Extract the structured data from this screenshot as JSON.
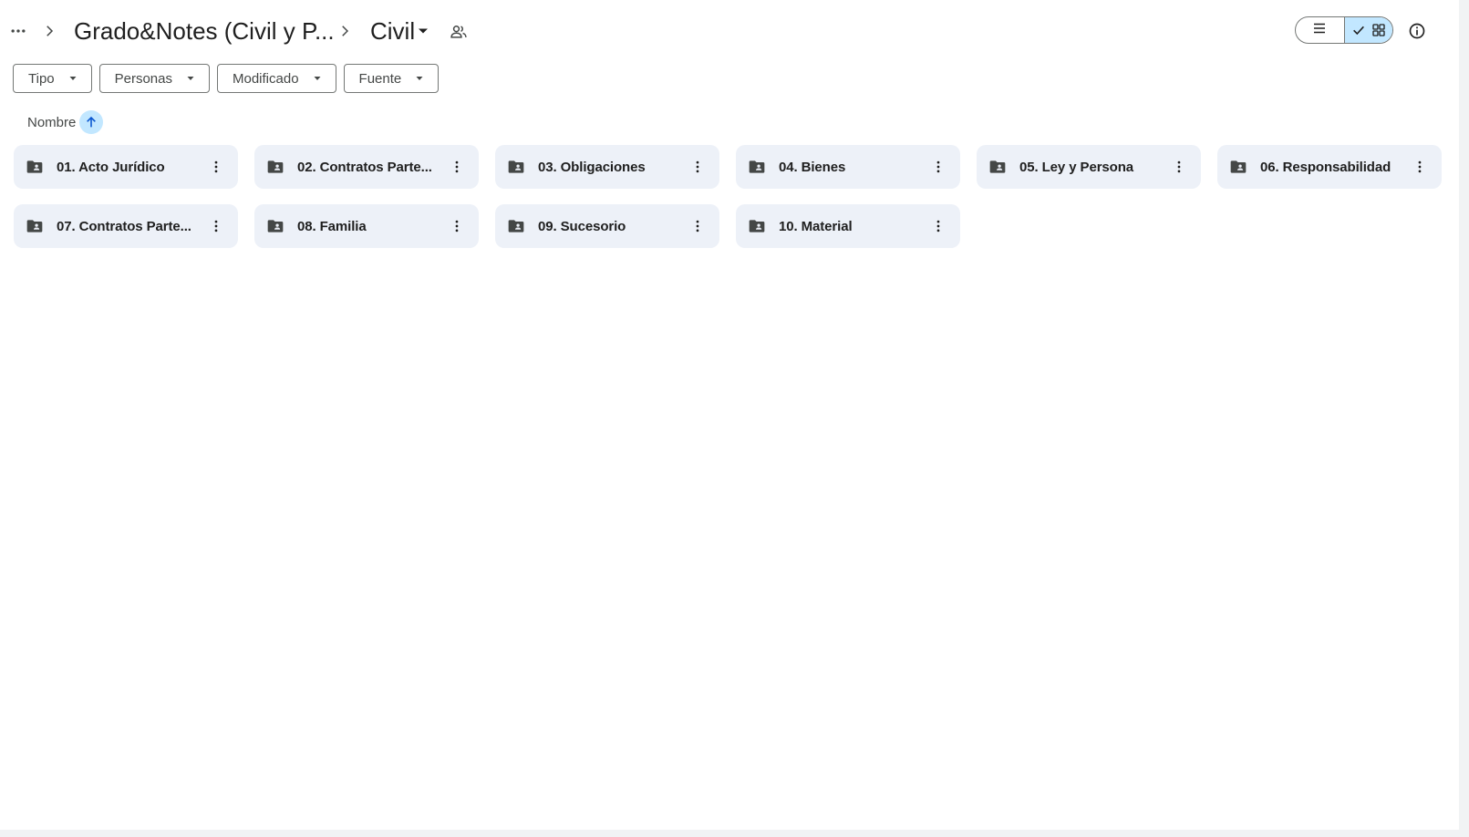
{
  "breadcrumb": {
    "overflow_icon": "more-horiz-icon",
    "separator_icon": "chevron-right-icon",
    "parent": "Grado&Notes (Civil y P...",
    "current": "Civil",
    "current_dropdown_icon": "arrow-drop-down-icon",
    "shared_icon": "shared-people-icon"
  },
  "view_toggle": {
    "list_icon": "list-view-icon",
    "grid_icon": "grid-view-icon",
    "active": "grid",
    "check_icon": "check-icon"
  },
  "details_icon": "info-icon",
  "filters": [
    {
      "label": "Tipo"
    },
    {
      "label": "Personas"
    },
    {
      "label": "Modificado"
    },
    {
      "label": "Fuente"
    }
  ],
  "sort": {
    "label": "Nombre",
    "direction": "ascending",
    "icon": "arrow-upward-icon"
  },
  "folders": [
    {
      "name": "01. Acto Jurídico"
    },
    {
      "name": "02. Contratos Parte..."
    },
    {
      "name": "03. Obligaciones"
    },
    {
      "name": "04. Bienes"
    },
    {
      "name": "05. Ley y Persona"
    },
    {
      "name": "06. Responsabilidad"
    },
    {
      "name": "07. Contratos Parte..."
    },
    {
      "name": "08. Familia"
    },
    {
      "name": "09. Sucesorio"
    },
    {
      "name": "10. Material"
    }
  ],
  "colors": {
    "folder_card_bg": "#edf1f8",
    "accent_selected": "#c2e7ff",
    "text_primary": "#1f1f1f",
    "text_secondary": "#444746",
    "outline": "#747775"
  }
}
